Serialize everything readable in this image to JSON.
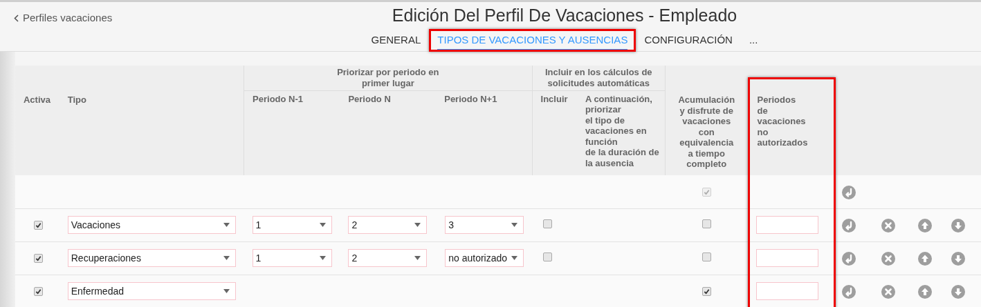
{
  "back_link": "Perfiles vacaciones",
  "title": "Edición Del Perfil De Vacaciones - Empleado",
  "tabs": [
    {
      "label": "GENERAL",
      "selected": false,
      "highlighted": false
    },
    {
      "label": "TIPOS DE VACACIONES Y AUSENCIAS",
      "selected": true,
      "highlighted": true
    },
    {
      "label": "CONFIGURACIÓN",
      "selected": false,
      "highlighted": false
    },
    {
      "label": "...",
      "selected": false,
      "highlighted": false
    }
  ],
  "table": {
    "columns": {
      "activa": "Activa",
      "tipo": "Tipo",
      "group_priorizar": "Priorizar por periodo en primer lugar",
      "periodo_n_1": "Periodo N-1",
      "periodo_n": "Periodo N",
      "periodo_n_plus_1": "Periodo N+1",
      "group_incluir": "Incluir en los cálculos de solicitudes automáticas",
      "incluir": "Incluir",
      "a_continuacion": "A continuación, priorizar\nel tipo de vacaciones en función\nde la duración de la ausencia",
      "acumulacion": "Acumulación y disfrute de vacaciones con equivalencia a tiempo completo",
      "periodos_no_autorizados": "Periodos de vacaciones no autorizados"
    },
    "periodos_column_highlighted": true,
    "rows": [
      {
        "kind": "template",
        "acumulacion": {
          "checked": true,
          "disabled": true
        }
      },
      {
        "kind": "type",
        "activa": true,
        "tipo": "Vacaciones",
        "periodo_n_1": "1",
        "periodo_n": "2",
        "periodo_n_plus_1": "3",
        "incluir": false,
        "acumulacion": {
          "checked": false,
          "disabled": false
        }
      },
      {
        "kind": "type",
        "activa": true,
        "tipo": "Recuperaciones",
        "periodo_n_1": "1",
        "periodo_n": "2",
        "periodo_n_plus_1": "no autorizado",
        "incluir": false,
        "acumulacion": {
          "checked": false,
          "disabled": false
        }
      },
      {
        "kind": "type",
        "activa": true,
        "tipo": "Enfermedad",
        "acumulacion": {
          "checked": true,
          "disabled": false
        }
      }
    ]
  }
}
